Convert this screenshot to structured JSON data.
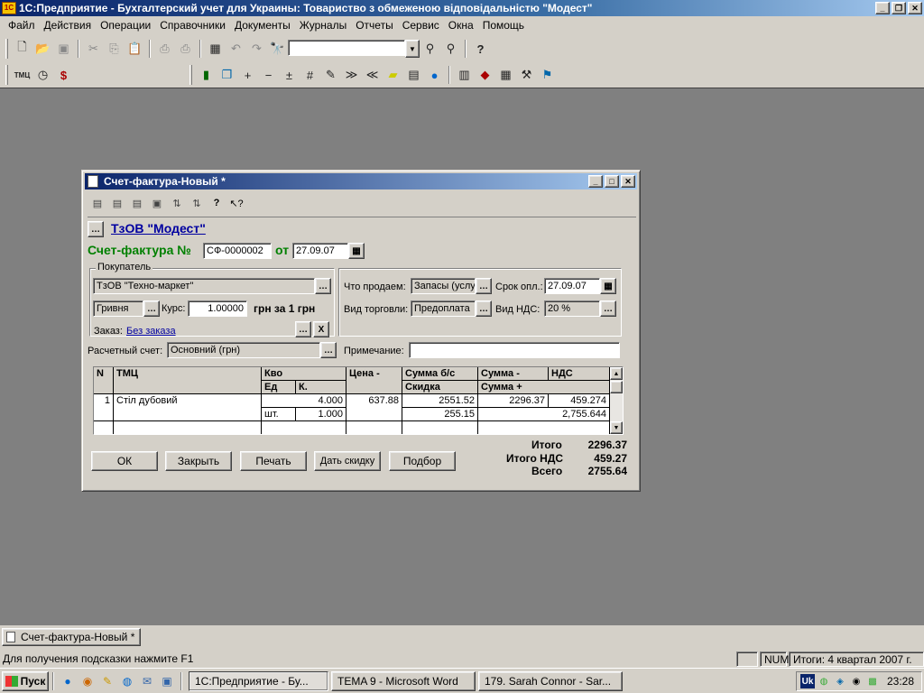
{
  "app": {
    "title": "1С:Предприятие - Бухгалтерский учет для Украины: Товариство з обмеженою відповідальністю \"Модест\"",
    "icon_label": "1С"
  },
  "menu": [
    "Файл",
    "Действия",
    "Операции",
    "Справочники",
    "Документы",
    "Журналы",
    "Отчеты",
    "Сервис",
    "Окна",
    "Помощь"
  ],
  "toolbar1": {
    "icons": [
      "new-doc-icon",
      "open-folder-icon",
      "save-icon",
      "cut-icon",
      "copy-icon",
      "paste-icon",
      "print-icon",
      "print-preview-icon",
      "calculator-icon",
      "undo-icon",
      "redo-icon",
      "find-icon",
      "search-next-icon",
      "search-prev-icon",
      "help-icon"
    ],
    "search_value": ""
  },
  "toolbar2": {
    "icons_left": [
      "tmc-icon",
      "clock-icon",
      "exchange-icon"
    ],
    "tmc_label": "ТМЦ",
    "icons_right": [
      "book-icon",
      "copy-doc-icon",
      "plus-icon",
      "minus-icon",
      "split-icon",
      "grid-icon",
      "pencil-icon",
      "forward-icon",
      "back-icon",
      "folder-icon",
      "kassa-icon",
      "globe-icon",
      "report-icon",
      "journal-icon",
      "table-icon",
      "tools-icon",
      "filter-icon"
    ]
  },
  "doc": {
    "window_title": "Счет-фактура-Новый *",
    "company_link": "ТзОВ \"Модест\"",
    "invoice_label": "Счет-фактура №",
    "invoice_number": "СФ-0000002",
    "date_label": "от",
    "date": "27.09.07",
    "buyer_group": "Покупатель",
    "buyer": "ТзОВ \"Техно-маркет\"",
    "currency": "Гривня",
    "rate_label": "Курс:",
    "rate": "1.00000",
    "rate_unit": "грн за 1 грн",
    "order_label": "Заказ:",
    "order_link": "Без заказа",
    "what_sell_label": "Что продаем:",
    "what_sell": "Запасы (услу",
    "pay_term_label": "Срок опл.:",
    "pay_term": "27.09.07",
    "trade_type_label": "Вид торговли:",
    "trade_type": "Предоплата",
    "vat_type_label": "Вид НДС:",
    "vat_type": "20 %",
    "account_label": "Расчетный счет:",
    "account": "Основний (грн)",
    "note_label": "Примечание:",
    "note": ""
  },
  "grid": {
    "headers": {
      "n": "N",
      "tmc": "ТМЦ",
      "qty": "Кво",
      "unit": "Ед",
      "k": "К.",
      "price": "Цена -",
      "sum_bs": "Сумма б/с",
      "discount": "Скидка",
      "sum_minus": "Сумма -",
      "vat": "НДС",
      "sum_plus": "Сумма +"
    },
    "rows": [
      {
        "n": "1",
        "tmc": "Стіл дубовий",
        "qty": "4.000",
        "unit": "шт.",
        "k": "1.000",
        "price": "637.88",
        "sum_bs": "2551.52",
        "discount": "255.15",
        "sum_minus": "2296.37",
        "vat": "459.274",
        "sum_plus": "2,755.644"
      }
    ]
  },
  "buttons": {
    "ok": "ОК",
    "close": "Закрыть",
    "print": "Печать",
    "discount": "Дать скидку",
    "select": "Подбор"
  },
  "totals": {
    "itogo_label": "Итого",
    "itogo": "2296.37",
    "vat_label": "Итого НДС",
    "vat": "459.27",
    "total_label": "Всего",
    "total": "2755.64"
  },
  "window_tab": "Счет-фактура-Новый *",
  "status": {
    "hint": "Для получения подсказки нажмите F1",
    "num": "NUM",
    "period": "Итоги: 4 квартал 2007 г."
  },
  "taskbar": {
    "start": "Пуск",
    "tasks": [
      "1С:Предприятие - Бу...",
      "TEMA 9 - Microsoft Word",
      "179. Sarah Connor - Sar..."
    ],
    "lang": "Uk",
    "clock": "23:28"
  }
}
